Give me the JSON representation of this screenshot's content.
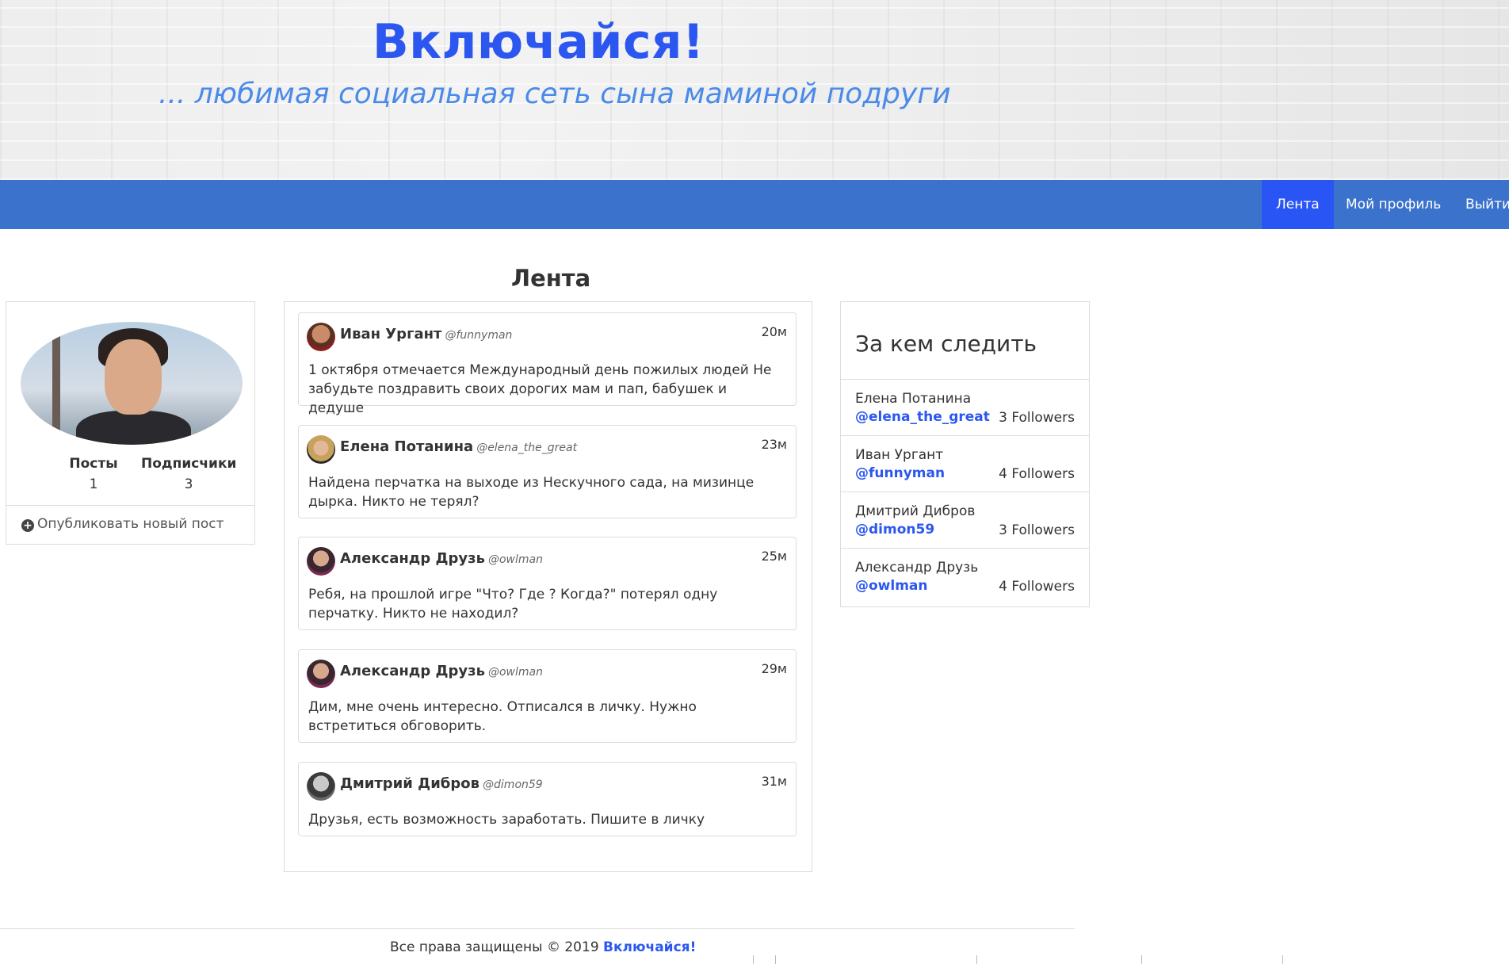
{
  "header": {
    "title": "Включайся!",
    "tagline": "... любимая социальная сеть сына маминой подруги"
  },
  "nav": {
    "items": [
      {
        "label": "Лента",
        "active": true
      },
      {
        "label": "Мой профиль",
        "active": false
      },
      {
        "label": "Выйти",
        "active": false
      }
    ]
  },
  "page": {
    "heading": "Лента"
  },
  "profile": {
    "posts_label": "Посты",
    "posts_value": "1",
    "followers_label": "Подписчики",
    "followers_value": "3",
    "publish_label": "Опубликовать новый пост",
    "publish_icon": "plus-circle-icon"
  },
  "feed": {
    "posts": [
      {
        "author": "Иван Ургант",
        "handle": "@funnyman",
        "time": "20м",
        "text": "1 октября отмечается Международный день пожилых людей Не забудьте поздравить своих дорогих мам и пап, бабушек и дедуше"
      },
      {
        "author": "Елена Потанина",
        "handle": "@elena_the_great",
        "time": "23м",
        "text": "Найдена перчатка на выходе из Нескучного сада, на мизинце дырка. Никто не терял?"
      },
      {
        "author": "Александр Друзь",
        "handle": "@owlman",
        "time": "25м",
        "text": "Ребя, на прошлой игре \"Что? Где ? Когда?\" потерял одну перчатку. Никто не находил?"
      },
      {
        "author": "Александр Друзь",
        "handle": "@owlman",
        "time": "29м",
        "text": "Дим, мне очень интересно. Отписался в личку. Нужно встретиться обговорить."
      },
      {
        "author": "Дмитрий Дибров",
        "handle": "@dimon59",
        "time": "31м",
        "text": "Друзья, есть возможность заработать. Пишите в личку"
      }
    ]
  },
  "follow": {
    "title": "За кем следить",
    "users": [
      {
        "name": "Елена Потанина",
        "handle": "@elena_the_great",
        "followers": "3 Followers"
      },
      {
        "name": "Иван Ургант",
        "handle": "@funnyman",
        "followers": "4 Followers"
      },
      {
        "name": "Дмитрий Дибров",
        "handle": "@dimon59",
        "followers": "3 Followers"
      },
      {
        "name": "Александр Друзь",
        "handle": "@owlman",
        "followers": "4 Followers"
      }
    ]
  },
  "footer": {
    "text": "Все права защищены © 2019 ",
    "brand": "Включайся!"
  },
  "colors": {
    "brand": "#2b57f0",
    "navbar": "#3b73cc",
    "nav_active": "#2a55f5"
  }
}
